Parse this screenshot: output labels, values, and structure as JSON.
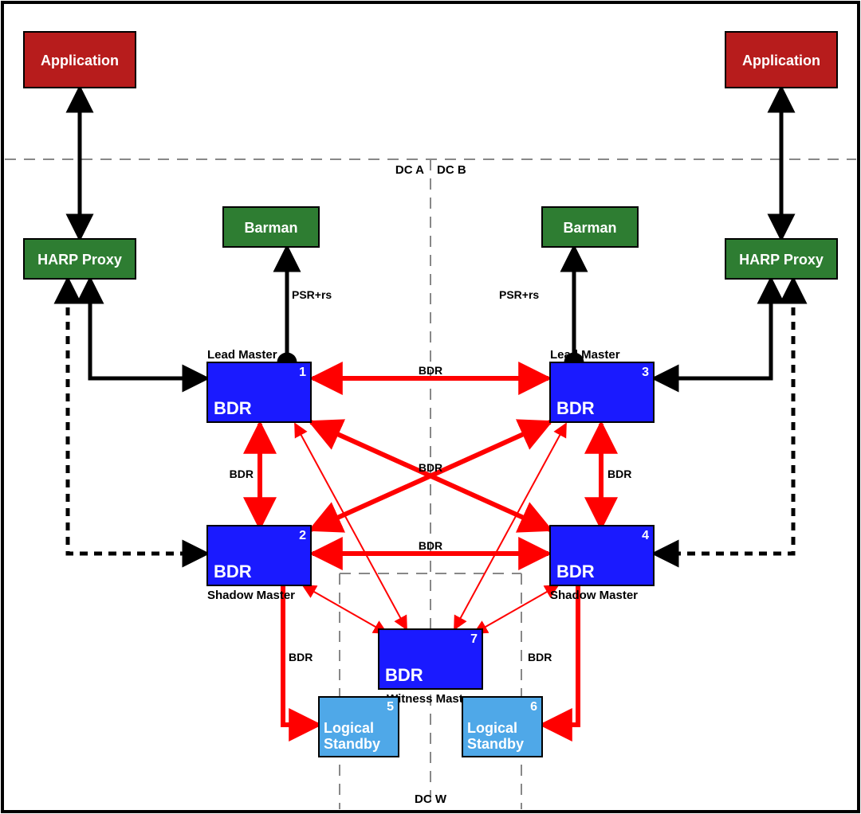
{
  "regions": {
    "dca": "DC A",
    "dcb": "DC B",
    "dcw": "DC W"
  },
  "nodes": {
    "app_left": {
      "label": "Application"
    },
    "app_right": {
      "label": "Application"
    },
    "harp_left": {
      "label": "HARP Proxy"
    },
    "harp_right": {
      "label": "HARP Proxy"
    },
    "barman_a": {
      "label": "Barman"
    },
    "barman_b": {
      "label": "Barman"
    },
    "bdr1": {
      "label": "BDR",
      "num": "1",
      "role": "Lead Master"
    },
    "bdr2": {
      "label": "BDR",
      "num": "2",
      "role": "Shadow Master"
    },
    "bdr3": {
      "label": "BDR",
      "num": "3",
      "role": "Lead Master"
    },
    "bdr4": {
      "label": "BDR",
      "num": "4",
      "role": "Shadow Master"
    },
    "bdr7": {
      "label": "BDR",
      "num": "7",
      "role": "Witness Master"
    },
    "ls5": {
      "label1": "Logical",
      "label2": "Standby",
      "num": "5"
    },
    "ls6": {
      "label1": "Logical",
      "label2": "Standby",
      "num": "6"
    }
  },
  "edge_labels": {
    "psr_a": "PSR+rs",
    "psr_b": "PSR+rs",
    "bdr13": "BDR",
    "bdr24": "BDR",
    "bdr12": "BDR",
    "bdr34": "BDR",
    "bdr_x": "BDR",
    "bdr25": "BDR",
    "bdr46": "BDR"
  },
  "colors": {
    "app": "#b71c1c",
    "green": "#2e7d32",
    "blue": "#1a1aff",
    "lightblue": "#4fa8e8",
    "red": "#ff0000",
    "black": "#000000",
    "grey": "#888888"
  }
}
